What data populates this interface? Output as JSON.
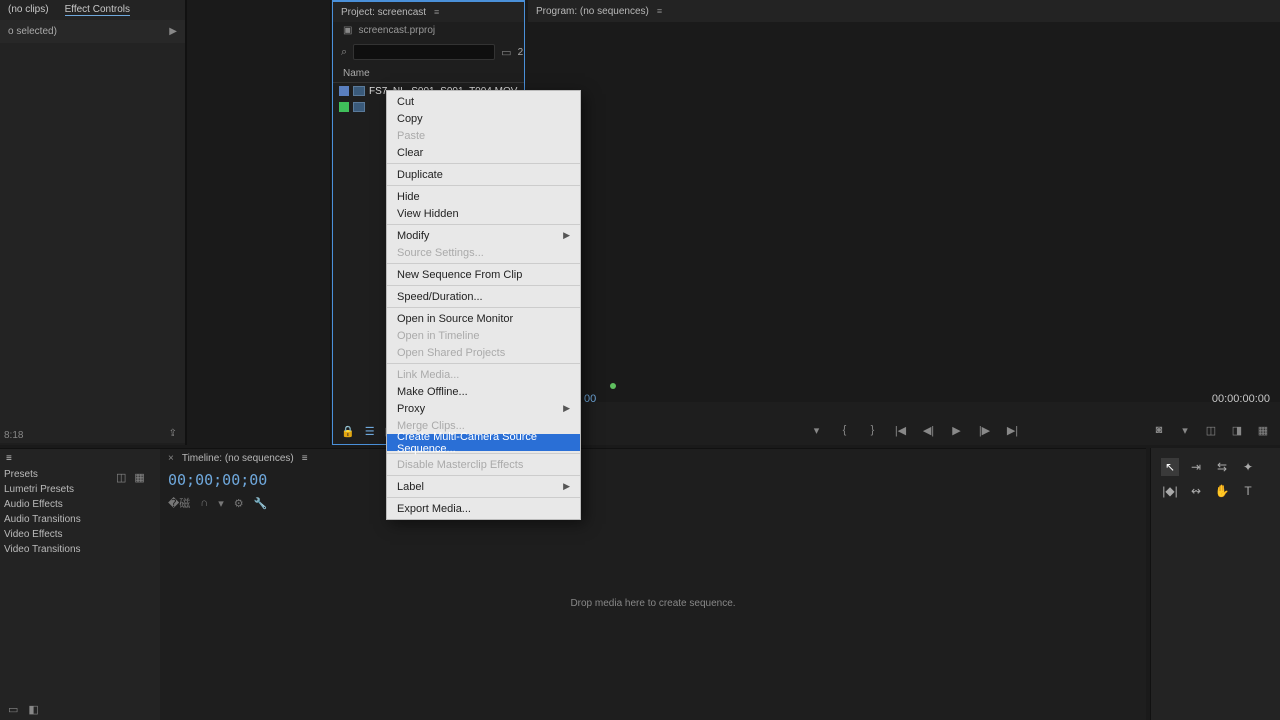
{
  "source": {
    "tab_no_clips": "(no clips)",
    "tab_effect_controls": "Effect Controls",
    "sub": "o selected)",
    "footer_time": "8:18"
  },
  "project": {
    "title": "Project: screencast",
    "filename": "screencast.prproj",
    "search_placeholder": "",
    "col_name": "Name",
    "item1": "FS7_NL_S001_S001_T004.MOV",
    "count_badge": "2"
  },
  "program": {
    "title": "Program: (no sequences)",
    "timecode_left": "00",
    "timecode_right": "00:00:00:00"
  },
  "timeline": {
    "title": "Timeline: (no sequences)",
    "timecode": "00;00;00;00",
    "drop_hint": "Drop media here to create sequence."
  },
  "effects": {
    "presets": "Presets",
    "lumetri": "Lumetri Presets",
    "audio_fx": "Audio Effects",
    "audio_tr": "Audio Transitions",
    "video_fx": "Video Effects",
    "video_tr": "Video Transitions"
  },
  "menu": {
    "cut": "Cut",
    "copy": "Copy",
    "paste": "Paste",
    "clear": "Clear",
    "duplicate": "Duplicate",
    "hide": "Hide",
    "view_hidden": "View Hidden",
    "modify": "Modify",
    "source_settings": "Source Settings...",
    "new_sequence": "New Sequence From Clip",
    "speed_duration": "Speed/Duration...",
    "open_source_monitor": "Open in Source Monitor",
    "open_timeline": "Open in Timeline",
    "open_shared": "Open Shared Projects",
    "link_media": "Link Media...",
    "make_offline": "Make Offline...",
    "proxy": "Proxy",
    "merge_clips": "Merge Clips...",
    "multicam": "Create Multi-Camera Source Sequence...",
    "disable_masterclip": "Disable Masterclip Effects",
    "label": "Label",
    "export_media": "Export Media..."
  }
}
